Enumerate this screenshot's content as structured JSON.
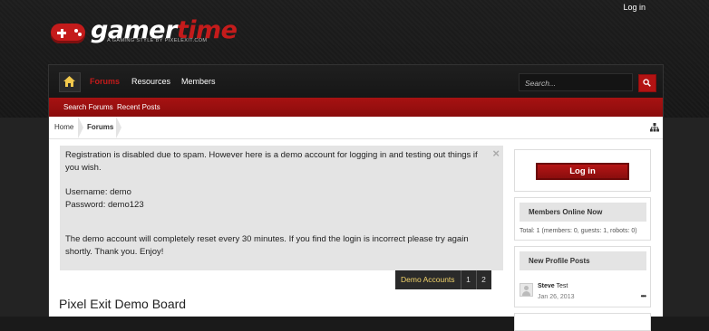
{
  "top": {
    "login_label": "Log in"
  },
  "logo": {
    "word1": "gamer",
    "word2": "time",
    "tagline": "A GAMING STYLE BY PIXELEXIT.COM"
  },
  "nav": {
    "items": [
      {
        "label": "Forums",
        "active": true
      },
      {
        "label": "Resources",
        "active": false
      },
      {
        "label": "Members",
        "active": false
      }
    ],
    "search_placeholder": "Search..."
  },
  "subnav": {
    "items": [
      "Search Forums",
      "Recent Posts"
    ]
  },
  "breadcrumb": {
    "items": [
      "Home",
      "Forums"
    ]
  },
  "notice": {
    "line1": "Registration is disabled due to spam. However here is a demo account for logging in and testing out things if you wish.",
    "username": "Username: demo",
    "password": "Password: demo123",
    "reset": "The demo account will completely reset every 30 minutes. If you find the login is incorrect please try again shortly. Thank you. Enjoy!",
    "close": "×"
  },
  "pagenav": {
    "label": "Demo Accounts",
    "pages": [
      "1",
      "2"
    ]
  },
  "board_title": "Pixel Exit Demo Board",
  "sidebar": {
    "login_button": "Log in",
    "members_online": {
      "title": "Members Online Now",
      "summary": "Total: 1 (members: 0, guests: 1, robots: 0)"
    },
    "profile_posts": {
      "title": "New Profile Posts",
      "user": "Steve",
      "text": "Test",
      "date": "Jan 26, 2013",
      "more": "•••"
    }
  },
  "colors": {
    "accent": "#c41b1b",
    "nav_bg": "#1a1a1a",
    "notice_bg": "#e4e4e4",
    "pagenav_label": "#f3d46a"
  }
}
